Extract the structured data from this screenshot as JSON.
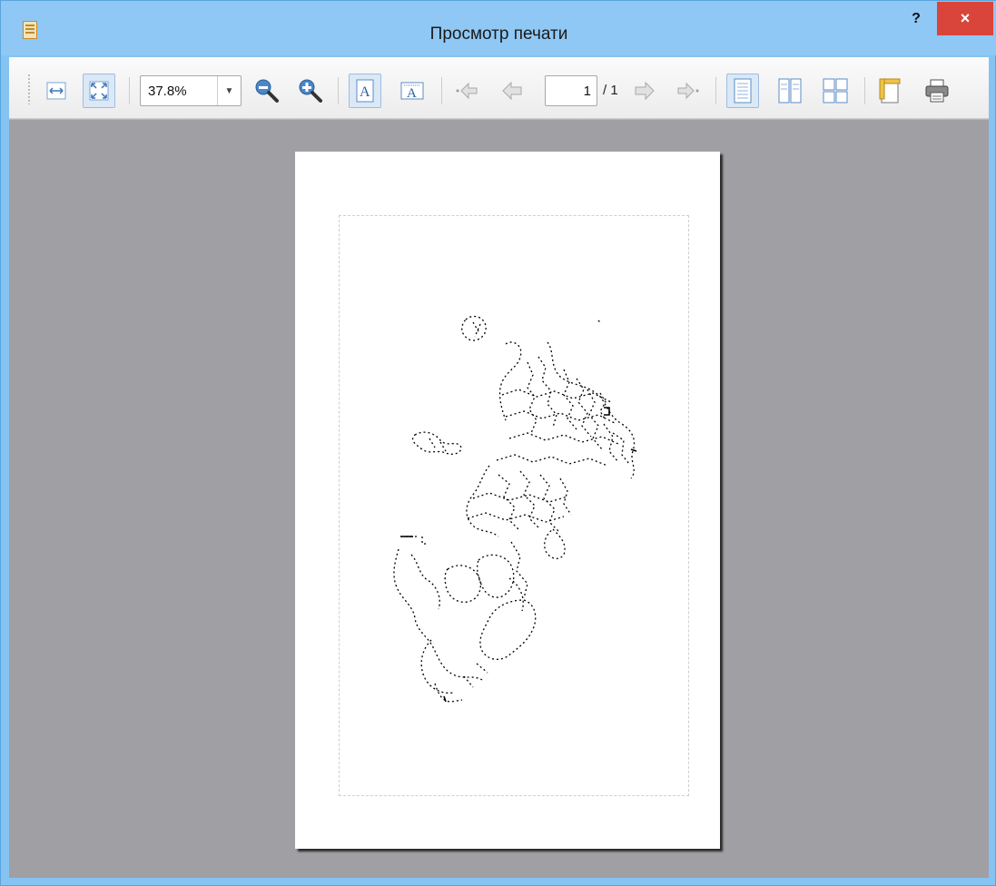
{
  "window": {
    "title": "Просмотр печати",
    "help_label": "?",
    "close_label": "×"
  },
  "toolbar": {
    "zoom_value": "37.8%",
    "current_page": "1",
    "total_pages": "/ 1",
    "icons": [
      "fit-width-icon",
      "fit-page-icon",
      "zoom-out-icon",
      "zoom-in-icon",
      "portrait-icon",
      "landscape-icon",
      "first-page-icon",
      "previous-page-icon",
      "next-page-icon",
      "last-page-icon",
      "single-page-icon",
      "facing-pages-icon",
      "overview-icon",
      "page-setup-icon",
      "print-icon"
    ]
  },
  "colors": {
    "title_bar": "#8fc8f5",
    "close_button": "#d9453a",
    "canvas": "#a09fa4",
    "accent": "#4a83c4"
  }
}
